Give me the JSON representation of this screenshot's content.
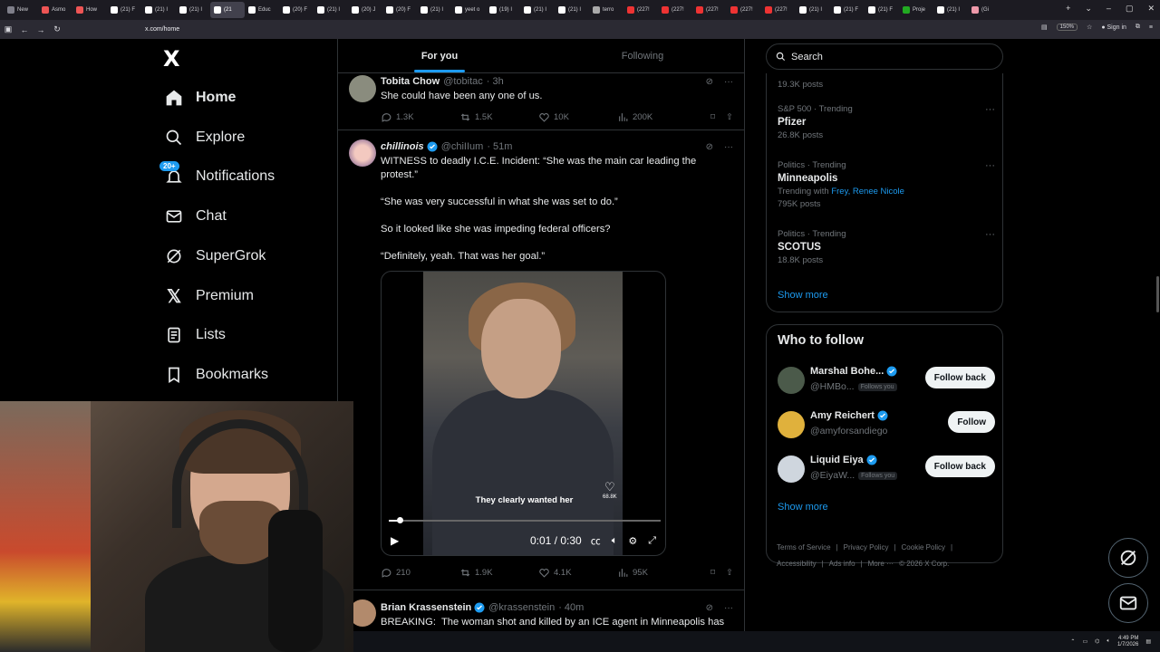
{
  "browser": {
    "tabs": [
      "New",
      "Asmo",
      "How",
      "(21) F",
      "(21) I",
      "(21) I",
      "(21",
      "Educ",
      "(20) F",
      "(21) I",
      "(20) J",
      "(20) F",
      "(21) I",
      "yeet o",
      "(19) I",
      "(21) I",
      "(21) I",
      "terro",
      "(227!",
      "(227!",
      "(227!",
      "(227!",
      "(227!",
      "(21) I",
      "(21) F",
      "(21) F",
      "Proje",
      "(21) I",
      "(Gi"
    ],
    "active_tab_index": 6,
    "url": "x.com/home",
    "zoom": "150%",
    "signin": "Sign in"
  },
  "sidebar": {
    "logo": "X",
    "items": [
      {
        "label": "Home",
        "icon": "home-icon"
      },
      {
        "label": "Explore",
        "icon": "search-icon"
      },
      {
        "label": "Notifications",
        "icon": "bell-icon",
        "badge": "20+"
      },
      {
        "label": "Chat",
        "icon": "mail-icon"
      },
      {
        "label": "SuperGrok",
        "icon": "grok-icon"
      },
      {
        "label": "Premium",
        "icon": "x-icon"
      },
      {
        "label": "Lists",
        "icon": "list-icon"
      },
      {
        "label": "Bookmarks",
        "icon": "bookmark-icon"
      }
    ]
  },
  "feed": {
    "tabs": [
      "For you",
      "Following"
    ],
    "tweets": [
      {
        "name": "Tobita Chow",
        "handle": "@tobitac",
        "time": "· 3h",
        "text": "She could have been any one of us.",
        "replies": "1.3K",
        "reposts": "1.5K",
        "likes": "10K",
        "views": "200K"
      },
      {
        "name": "chillinois",
        "handle": "@chiIIum",
        "time": "· 51m",
        "text": "WITNESS to deadly I.C.E. Incident: “She was the main car leading the protest.”\n\n“She was very successful in what she was set to do.”\n\nSo it looked like she was impeding federal officers?\n\n“Definitely, yeah. That was her goal.”",
        "video_caption": "They clearly wanted her",
        "video_likes": "68.8K",
        "video_time": "0:01 / 0:30",
        "replies": "210",
        "reposts": "1.9K",
        "likes": "4.1K",
        "views": "95K"
      },
      {
        "name": "Brian Krassenstein",
        "handle": "@krassenstein",
        "time": "· 40m",
        "text": "BREAKING:  The woman shot and killed by an ICE agent in Minneapolis has"
      }
    ]
  },
  "right": {
    "search_placeholder": "Search",
    "trends": [
      {
        "count": "19.3K posts"
      },
      {
        "category": "S&P 500 · Trending",
        "title": "Pfizer",
        "count": "26.8K posts"
      },
      {
        "category": "Politics · Trending",
        "title": "Minneapolis",
        "trending_with_label": "Trending with",
        "trending_with": "Frey, Renee Nicole",
        "count": "795K posts"
      },
      {
        "category": "Politics · Trending",
        "title": "SCOTUS",
        "count": "18.8K posts"
      }
    ],
    "show_more": "Show more",
    "who_to_follow": {
      "title": "Who to follow",
      "users": [
        {
          "name": "Marshal Bohe...",
          "handle": "@HMBo...",
          "follows_you": "Follows you",
          "button": "Follow back"
        },
        {
          "name": "Amy Reichert",
          "handle": "@amyforsandiego",
          "follows_you": "",
          "button": "Follow"
        },
        {
          "name": "Liquid Eiya",
          "handle": "@EiyaW...",
          "follows_you": "Follows you",
          "button": "Follow back"
        }
      ],
      "show_more": "Show more"
    },
    "footer": [
      "Terms of Service",
      "|",
      "Privacy Policy",
      "|",
      "Cookie Policy",
      "|",
      "Accessibility",
      "|",
      "Ads info",
      "|",
      "More ···",
      "© 2026 X Corp."
    ]
  },
  "taskbar": {
    "time": "4:49 PM",
    "date": "1/7/2026"
  }
}
